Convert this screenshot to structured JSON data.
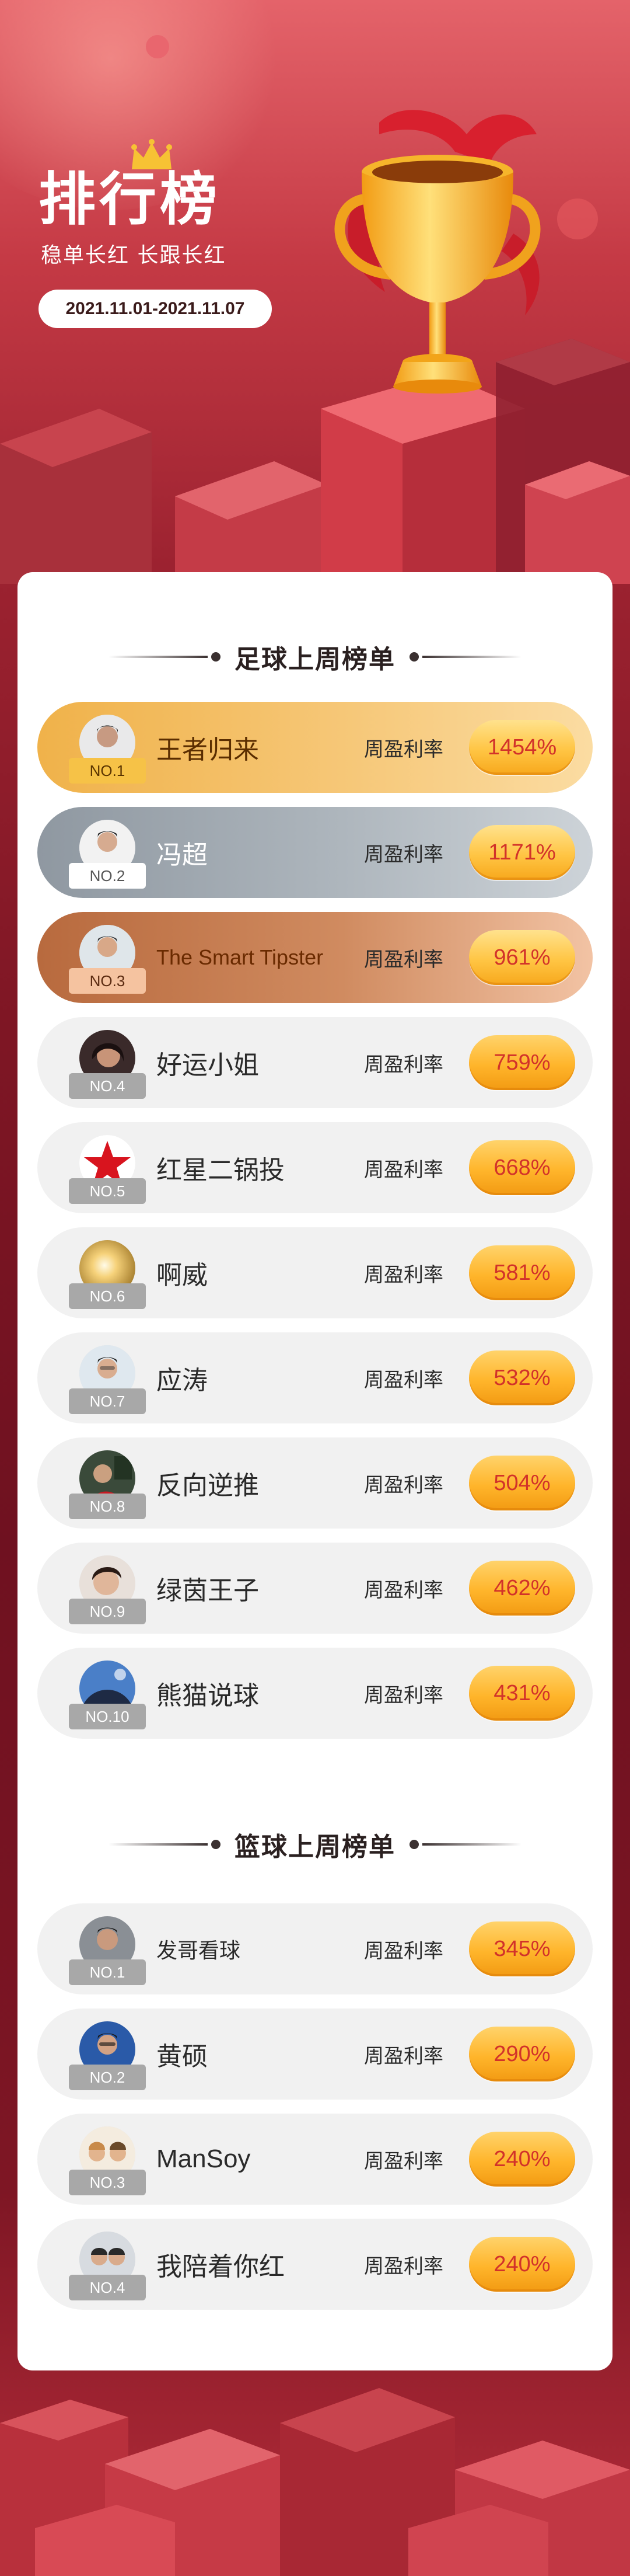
{
  "header": {
    "title": "排行榜",
    "subtitle": "稳单长红 长跟长红",
    "date_range": "2021.11.01-2021.11.07"
  },
  "football": {
    "title": "足球上周榜单",
    "metric_label": "周盈利率",
    "rows": [
      {
        "rank": "NO.1",
        "name": "王者归来",
        "rate": "1454%"
      },
      {
        "rank": "NO.2",
        "name": "冯超",
        "rate": "1171%"
      },
      {
        "rank": "NO.3",
        "name": "The Smart Tipster",
        "rate": "961%"
      },
      {
        "rank": "NO.4",
        "name": "好运小姐",
        "rate": "759%"
      },
      {
        "rank": "NO.5",
        "name": "红星二锅投",
        "rate": "668%"
      },
      {
        "rank": "NO.6",
        "name": "啊威",
        "rate": "581%"
      },
      {
        "rank": "NO.7",
        "name": "应涛",
        "rate": "532%"
      },
      {
        "rank": "NO.8",
        "name": "反向逆推",
        "rate": "504%"
      },
      {
        "rank": "NO.9",
        "name": "绿茵王子",
        "rate": "462%"
      },
      {
        "rank": "NO.10",
        "name": "熊猫说球",
        "rate": "431%"
      }
    ]
  },
  "basketball": {
    "title": "篮球上周榜单",
    "metric_label": "周盈利率",
    "rows": [
      {
        "rank": "NO.1",
        "name": "发哥看球",
        "rate": "345%"
      },
      {
        "rank": "NO.2",
        "name": "黄硕",
        "rate": "290%"
      },
      {
        "rank": "NO.3",
        "name": "ManSoy",
        "rate": "240%"
      },
      {
        "rank": "NO.4",
        "name": "我陪着你红",
        "rate": "240%"
      }
    ]
  },
  "colors": {
    "background": "#7e1624",
    "accent": "#e23a44",
    "gold": "#f0b24a",
    "rate_text": "#d2322a"
  }
}
